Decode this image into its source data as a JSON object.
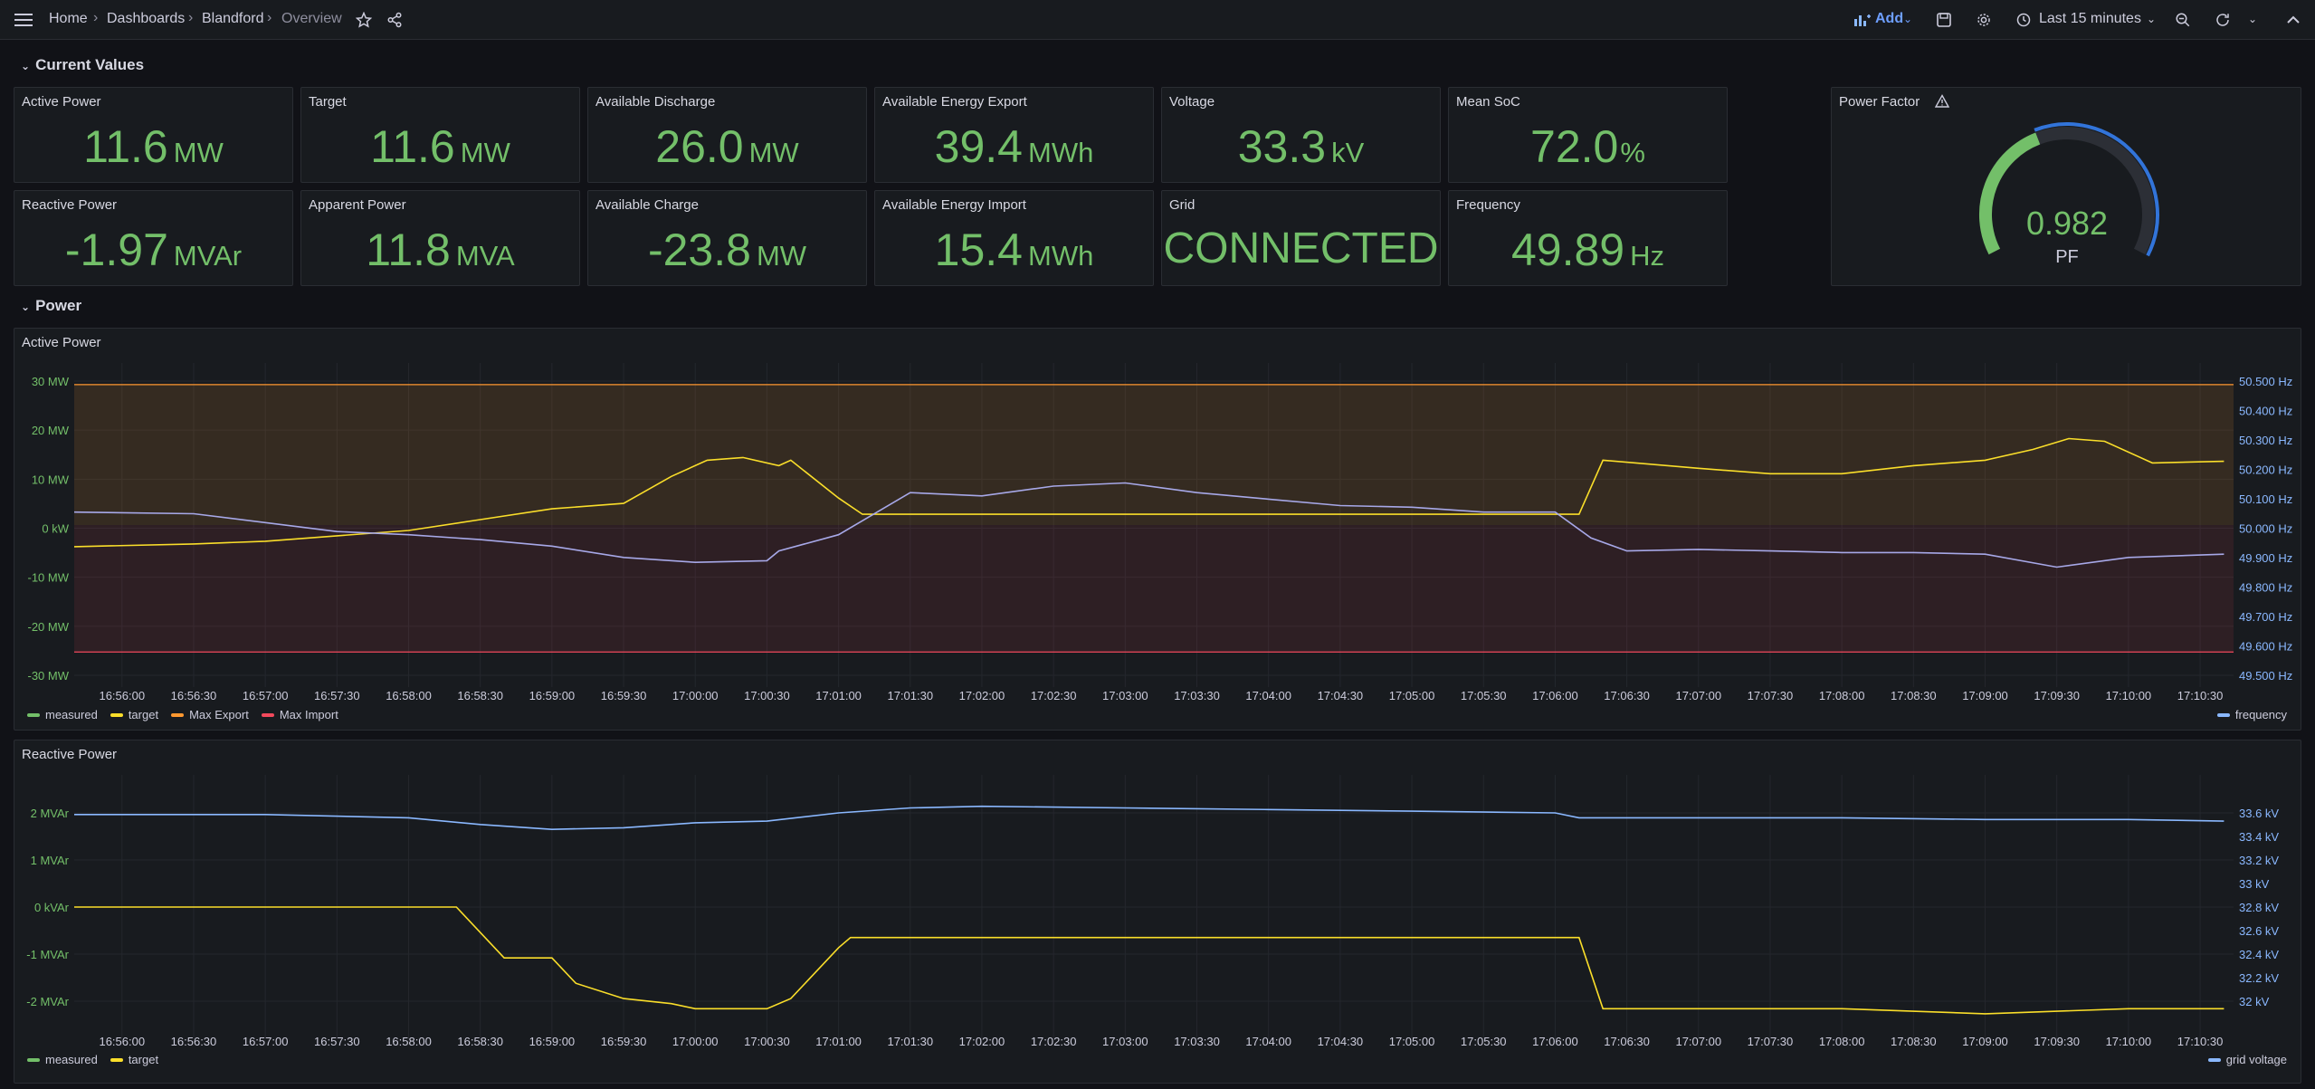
{
  "nav": {
    "breadcrumbs": [
      "Home",
      "Dashboards",
      "Blandford",
      "Overview"
    ],
    "add_label": "Add",
    "time_range": "Last 15 minutes"
  },
  "rows": {
    "current_values": "Current Values",
    "power": "Power"
  },
  "stats": [
    {
      "title": "Active Power",
      "value": "11.6",
      "unit": "MW"
    },
    {
      "title": "Target",
      "value": "11.6",
      "unit": "MW"
    },
    {
      "title": "Available Discharge",
      "value": "26.0",
      "unit": "MW"
    },
    {
      "title": "Available Energy Export",
      "value": "39.4",
      "unit": "MWh"
    },
    {
      "title": "Voltage",
      "value": "33.3",
      "unit": "kV"
    },
    {
      "title": "Mean SoC",
      "value": "72.0",
      "unit": "%"
    },
    {
      "title": "Reactive Power",
      "value": "-1.97",
      "unit": "MVAr"
    },
    {
      "title": "Apparent Power",
      "value": "11.8",
      "unit": "MVA"
    },
    {
      "title": "Available Charge",
      "value": "-23.8",
      "unit": "MW"
    },
    {
      "title": "Available Energy Import",
      "value": "15.4",
      "unit": "MWh"
    },
    {
      "title": "Grid",
      "value": "CONNECTED",
      "unit": ""
    },
    {
      "title": "Frequency",
      "value": "49.89",
      "unit": "Hz"
    }
  ],
  "power_factor": {
    "title": "Power Factor",
    "value": "0.982",
    "unit": "PF",
    "fraction": 0.982
  },
  "colors": {
    "green": "#73bf69",
    "yellow": "#fade2a",
    "orange": "#ff9830",
    "red": "#f2495c",
    "blue": "#8ab8ff",
    "gauge_blue": "#3274d9",
    "frequency_line": "#a7a8e8"
  },
  "x_ticks": [
    "16:56:00",
    "16:56:30",
    "16:57:00",
    "16:57:30",
    "16:58:00",
    "16:58:30",
    "16:59:00",
    "16:59:30",
    "17:00:00",
    "17:00:30",
    "17:01:00",
    "17:01:30",
    "17:02:00",
    "17:02:30",
    "17:03:00",
    "17:03:30",
    "17:04:00",
    "17:04:30",
    "17:05:00",
    "17:05:30",
    "17:06:00",
    "17:06:30",
    "17:07:00",
    "17:07:30",
    "17:08:00",
    "17:08:30",
    "17:09:00",
    "17:09:30",
    "17:10:00",
    "17:10:30"
  ],
  "chart_data": [
    {
      "type": "line",
      "title": "Active Power",
      "y_ticks": [
        "30 MW",
        "20 MW",
        "10 MW",
        "0 kW",
        "-10 MW",
        "-20 MW",
        "-30 MW"
      ],
      "y2_ticks": [
        "50.500 Hz",
        "50.400 Hz",
        "50.300 Hz",
        "50.200 Hz",
        "50.100 Hz",
        "50.000 Hz",
        "49.900 Hz",
        "49.800 Hz",
        "49.700 Hz",
        "49.600 Hz",
        "49.500 Hz"
      ],
      "ylim": [
        -30,
        30
      ],
      "y2lim": [
        49.5,
        50.5
      ],
      "legend": [
        "measured",
        "target",
        "Max Export",
        "Max Import"
      ],
      "legend_right": [
        "frequency"
      ],
      "max_export": 26,
      "max_import": -23.5,
      "series": [
        {
          "name": "target",
          "axis": "left",
          "color": "yellow",
          "x": [
            "16:55:40",
            "16:56:30",
            "16:57:00",
            "16:57:30",
            "16:58:00",
            "16:58:30",
            "16:59:00",
            "16:59:30",
            "16:59:50",
            "17:00:05",
            "17:00:20",
            "17:00:35",
            "17:00:40",
            "17:01:00",
            "17:01:10",
            "17:01:15",
            "17:06:00",
            "17:06:10",
            "17:06:20",
            "17:07:00",
            "17:07:30",
            "17:08:00",
            "17:08:30",
            "17:09:00",
            "17:09:20",
            "17:09:35",
            "17:09:50",
            "17:10:10",
            "17:10:40"
          ],
          "values": [
            -4,
            -3.5,
            -3,
            -2,
            -1,
            1,
            3,
            4,
            9,
            12,
            12.5,
            11,
            12,
            5,
            2,
            2,
            2,
            2,
            12,
            10.5,
            9.5,
            9.5,
            11,
            12,
            14,
            16,
            15.5,
            11.5,
            11.8
          ]
        },
        {
          "name": "frequency",
          "axis": "right",
          "color": "frequency_line",
          "x": [
            "16:55:40",
            "16:56:30",
            "16:57:30",
            "16:58:00",
            "16:58:30",
            "16:59:00",
            "16:59:30",
            "17:00:00",
            "17:00:30",
            "17:00:35",
            "17:01:00",
            "17:01:30",
            "17:02:00",
            "17:02:30",
            "17:03:00",
            "17:03:30",
            "17:04:00",
            "17:04:30",
            "17:05:00",
            "17:05:30",
            "17:06:00",
            "17:06:15",
            "17:06:30",
            "17:07:00",
            "17:07:30",
            "17:08:00",
            "17:08:30",
            "17:09:00",
            "17:09:30",
            "17:10:00",
            "17:10:40"
          ],
          "values": [
            50.04,
            50.035,
            49.98,
            49.97,
            49.955,
            49.935,
            49.9,
            49.885,
            49.89,
            49.92,
            49.97,
            50.1,
            50.09,
            50.12,
            50.13,
            50.1,
            50.08,
            50.06,
            50.055,
            50.04,
            50.04,
            49.96,
            49.92,
            49.925,
            49.92,
            49.915,
            49.915,
            49.91,
            49.87,
            49.9,
            49.91
          ]
        }
      ]
    },
    {
      "type": "line",
      "title": "Reactive Power",
      "y_ticks": [
        "2 MVAr",
        "1 MVAr",
        "0 kVAr",
        "-1 MVAr",
        "-2 MVAr"
      ],
      "y2_ticks": [
        "33.6 kV",
        "33.4 kV",
        "33.2 kV",
        "33 kV",
        "32.8 kV",
        "32.6 kV",
        "32.4 kV",
        "32.2 kV",
        "32 kV"
      ],
      "ylim": [
        -2.6,
        2.6
      ],
      "y2lim": [
        32,
        33.6
      ],
      "legend": [
        "measured",
        "target"
      ],
      "legend_right": [
        "grid voltage"
      ],
      "series": [
        {
          "name": "target",
          "axis": "left",
          "color": "yellow",
          "x": [
            "16:55:40",
            "16:58:00",
            "16:58:20",
            "16:58:40",
            "16:59:00",
            "16:59:10",
            "16:59:30",
            "16:59:50",
            "17:00:00",
            "17:00:30",
            "17:00:40",
            "17:01:00",
            "17:01:05",
            "17:06:10",
            "17:06:20",
            "17:07:00",
            "17:08:00",
            "17:09:00",
            "17:10:00",
            "17:10:40"
          ],
          "values": [
            0,
            0,
            0,
            -1,
            -1,
            -1.5,
            -1.8,
            -1.9,
            -2,
            -2,
            -1.8,
            -0.8,
            -0.6,
            -0.6,
            -2,
            -2,
            -2,
            -2.1,
            -2,
            -2
          ]
        },
        {
          "name": "grid voltage",
          "axis": "right",
          "color": "blue",
          "x": [
            "16:55:40",
            "16:57:00",
            "16:58:00",
            "16:58:30",
            "16:59:00",
            "16:59:30",
            "17:00:00",
            "17:00:30",
            "17:01:00",
            "17:01:30",
            "17:02:00",
            "17:03:00",
            "17:04:00",
            "17:05:00",
            "17:06:00",
            "17:06:10",
            "17:07:00",
            "17:08:00",
            "17:09:00",
            "17:10:00",
            "17:10:40"
          ],
          "values": [
            33.36,
            33.36,
            33.34,
            33.3,
            33.27,
            33.28,
            33.31,
            33.32,
            33.37,
            33.4,
            33.41,
            33.4,
            33.39,
            33.38,
            33.37,
            33.34,
            33.34,
            33.34,
            33.33,
            33.33,
            33.32
          ]
        }
      ]
    }
  ]
}
